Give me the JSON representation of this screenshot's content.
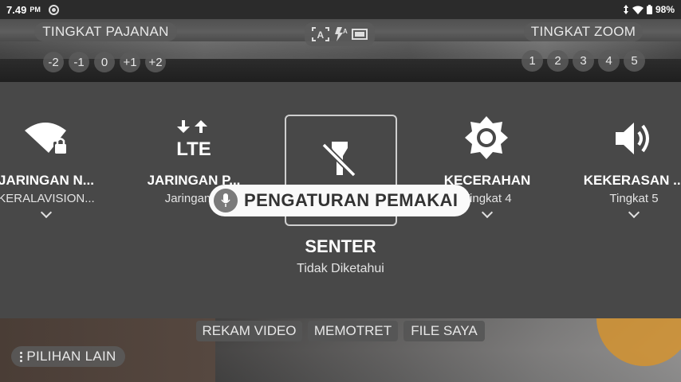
{
  "status_bar": {
    "time": "7.49",
    "ampm": "PM",
    "battery": "98%"
  },
  "camera": {
    "exposure_label": "TINGKAT PAJANAN",
    "exposure_levels": [
      "-2",
      "-1",
      "0",
      "+1",
      "+2"
    ],
    "zoom_label": "TINGKAT ZOOM",
    "zoom_levels": [
      "1",
      "2",
      "3",
      "4",
      "5"
    ],
    "modes": [
      "REKAM VIDEO",
      "MEMOTRET",
      "FILE SAYA"
    ],
    "more_options": "PILIHAN LAIN"
  },
  "quick_settings": {
    "tiles": [
      {
        "title": "JARINGAN N...",
        "sub": "KERALAVISION...",
        "icon": "wifi-locked-icon"
      },
      {
        "title": "JARINGAN P...",
        "sub": "Jaringan N",
        "icon": "lte-data-icon"
      },
      {
        "title": "SENTER",
        "sub": "Tidak Diketahui",
        "icon": "flashlight-off-icon"
      },
      {
        "title": "KECERAHAN",
        "sub": "Tingkat 4",
        "icon": "brightness-icon"
      },
      {
        "title": "KEKERASAN ...",
        "sub": "Tingkat 5",
        "icon": "volume-icon"
      }
    ],
    "lte_text": "LTE"
  },
  "voice_overlay": {
    "text": "PENGATURAN PEMAKAI",
    "icon": "mic-icon"
  },
  "colors": {
    "panel": "#484848",
    "status_bar": "#2b2b2b",
    "pill": "#5a5a5a"
  }
}
